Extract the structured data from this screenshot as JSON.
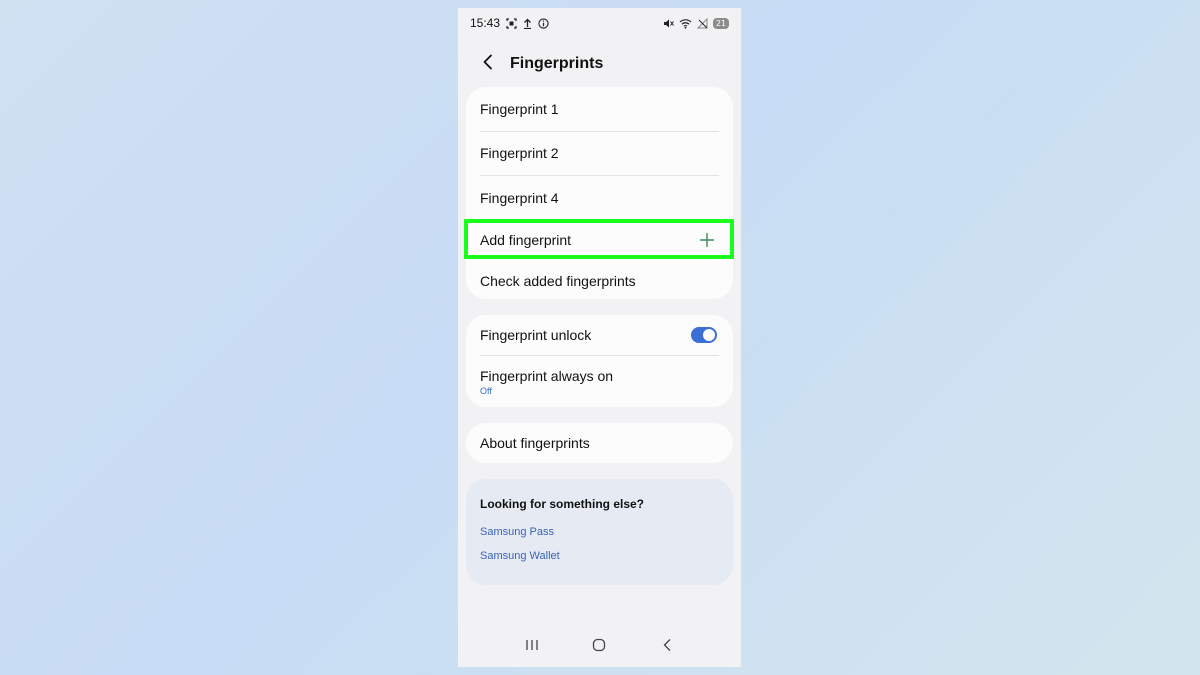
{
  "status_bar": {
    "time": "15:43",
    "left_icons": [
      "screenshot-icon",
      "upload-icon",
      "info-icon"
    ],
    "right_icons": [
      "mute-icon",
      "wifi-icon",
      "no-signal-icon"
    ],
    "battery": "21"
  },
  "header": {
    "title": "Fingerprints",
    "back_icon": "chevron-left-icon"
  },
  "fingerprints_card": {
    "items": [
      {
        "label": "Fingerprint 1"
      },
      {
        "label": "Fingerprint 2"
      },
      {
        "label": "Fingerprint 4"
      }
    ],
    "add_label": "Add fingerprint",
    "add_icon": "plus-icon",
    "check_label": "Check added fingerprints",
    "highlight_color": "#19ff1c"
  },
  "settings_card": {
    "unlock_label": "Fingerprint unlock",
    "unlock_enabled": true,
    "always_on_label": "Fingerprint always on",
    "always_on_value": "Off",
    "accent": "#3b6fd6"
  },
  "about_card": {
    "label": "About fingerprints"
  },
  "suggestions": {
    "title": "Looking for something else?",
    "links": [
      "Samsung Pass",
      "Samsung Wallet"
    ]
  },
  "nav_bar": {
    "icons": [
      "recents-icon",
      "home-icon",
      "back-icon"
    ]
  }
}
